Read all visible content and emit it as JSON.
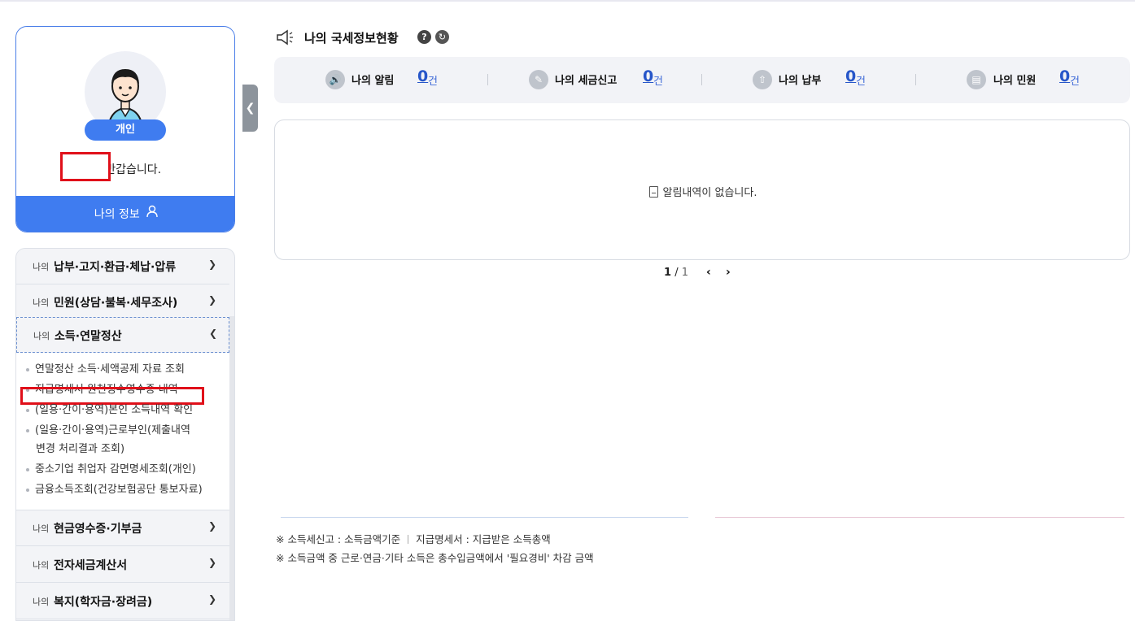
{
  "profile": {
    "badge": "개인",
    "greeting": "님 반갑습니다.",
    "my_info_button": "나의 정보"
  },
  "menu": {
    "prefix": "나의",
    "items": [
      {
        "title": "납부·고지·환급·체납·압류",
        "expanded": false
      },
      {
        "title": "민원(상담·불복·세무조사)",
        "expanded": false
      },
      {
        "title": "소득·연말정산",
        "expanded": true
      },
      {
        "title": "현금영수증·기부금",
        "expanded": false
      },
      {
        "title": "전자세금계산서",
        "expanded": false
      },
      {
        "title": "복지(학자금·장려금)",
        "expanded": false
      }
    ],
    "submenu": [
      "연말정산 소득·세액공제 자료 조회",
      "지급명세서·원천징수영수증 내역",
      "(일용·간이·용역)본인 소득내역 확인",
      "(일용·간이·용역)근로부인(제출내역",
      "변경 처리결과 조회)",
      "중소기업 취업자 감면명세조회(개인)",
      "금융소득조회(건강보험공단 통보자료)"
    ]
  },
  "main": {
    "title": "나의 국세정보현황",
    "help_icon": "?",
    "stats": [
      {
        "label": "나의 알림",
        "count": "0",
        "unit": "건",
        "icon": "megaphone-icon"
      },
      {
        "label": "나의 세금신고",
        "count": "0",
        "unit": "건",
        "icon": "document-edit-icon"
      },
      {
        "label": "나의 납부",
        "count": "0",
        "unit": "건",
        "icon": "payment-icon"
      },
      {
        "label": "나의 민원",
        "count": "0",
        "unit": "건",
        "icon": "clipboard-icon"
      }
    ],
    "empty_message": "알림내역이 없습니다.",
    "pager": {
      "current": "1",
      "separator": "/",
      "total": "1"
    },
    "notes": {
      "line1_a": "※ 소득세신고 : 소득금액기준",
      "line1_b": "지급명세서 : 지급받은 소득총액",
      "line2": "※ 소득금액 중 근로·연금·기타 소득은 총수입금액에서 '필요경비' 차감 금액"
    }
  },
  "colors": {
    "accent": "#3f7cf0",
    "highlight": "#e0101a",
    "count": "#2756c9"
  }
}
